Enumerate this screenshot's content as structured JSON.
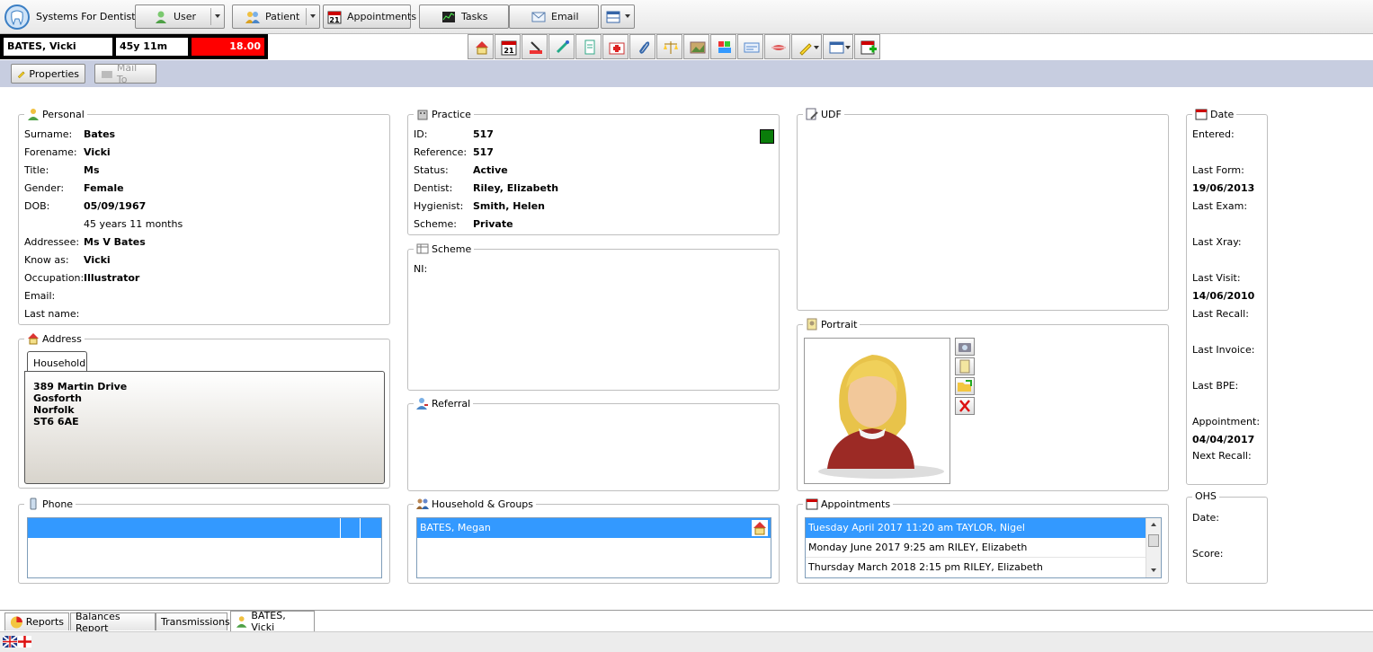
{
  "app": {
    "title": "Systems For Dentists"
  },
  "toolbar": {
    "user": "User",
    "patient": "Patient",
    "appointments": "Appointments",
    "tasks": "Tasks",
    "email": "Email"
  },
  "patient_bar": {
    "name": "BATES, Vicki",
    "age": "45y 11m",
    "balance": "18.00"
  },
  "subtoolbar": {
    "properties": "Properties",
    "mail_to": "Mail To"
  },
  "personal": {
    "title": "Personal",
    "rows": [
      {
        "label": "Surname:",
        "value": "Bates"
      },
      {
        "label": "Forename:",
        "value": "Vicki"
      },
      {
        "label": "Title:",
        "value": "Ms"
      },
      {
        "label": "Gender:",
        "value": "Female"
      },
      {
        "label": "DOB:",
        "value": "05/09/1967"
      },
      {
        "label": "",
        "value": "45 years 11 months"
      },
      {
        "label": "Addressee:",
        "value": "Ms V Bates"
      },
      {
        "label": "Know as:",
        "value": "Vicki"
      },
      {
        "label": "Occupation:",
        "value": "Illustrator"
      },
      {
        "label": "Email:",
        "value": ""
      },
      {
        "label": "Last name:",
        "value": ""
      }
    ]
  },
  "address": {
    "title": "Address",
    "tab": "Household",
    "lines": [
      "389 Martin Drive",
      "Gosforth",
      "Norfolk",
      "ST6 6AE"
    ]
  },
  "phone": {
    "title": "Phone"
  },
  "practice": {
    "title": "Practice",
    "rows": [
      {
        "label": "ID:",
        "value": "517"
      },
      {
        "label": "Reference:",
        "value": "517"
      },
      {
        "label": "Status:",
        "value": "Active"
      },
      {
        "label": "Dentist:",
        "value": "Riley, Elizabeth"
      },
      {
        "label": "Hygienist:",
        "value": "Smith, Helen"
      },
      {
        "label": "Scheme:",
        "value": "Private"
      }
    ],
    "status_color": "#0a7d0a"
  },
  "scheme": {
    "title": "Scheme",
    "ni_label": "NI:"
  },
  "referral": {
    "title": "Referral"
  },
  "household": {
    "title": "Household & Groups",
    "items": [
      "BATES, Megan"
    ]
  },
  "udf": {
    "title": "UDF"
  },
  "portrait": {
    "title": "Portrait"
  },
  "appointments": {
    "title": "Appointments",
    "items": [
      "Tuesday April 2017 11:20 am TAYLOR, Nigel",
      "Monday June 2017 9:25 am RILEY, Elizabeth",
      "Thursday March 2018 2:15 pm RILEY, Elizabeth"
    ]
  },
  "date": {
    "title": "Date",
    "rows": [
      {
        "label": "Entered:",
        "value": ""
      },
      {
        "label": "Last Form:",
        "value": "19/06/2013"
      },
      {
        "label": "Last Exam:",
        "value": ""
      },
      {
        "label": "Last Xray:",
        "value": ""
      },
      {
        "label": "Last Visit:",
        "value": "14/06/2010"
      },
      {
        "label": "Last Recall:",
        "value": ""
      },
      {
        "label": "Last Invoice:",
        "value": ""
      },
      {
        "label": "Last BPE:",
        "value": ""
      },
      {
        "label": "Appointment:",
        "value": "04/04/2017"
      },
      {
        "label": "Next Recall:",
        "value": ""
      }
    ]
  },
  "ohs": {
    "title": "OHS",
    "date_label": "Date:",
    "score_label": "Score:"
  },
  "bottom_tabs": [
    "Reports",
    "Balances Report",
    "Transmissions",
    "BATES, Vicki"
  ],
  "colors": {
    "balance_bg": "#ff0000",
    "selection": "#3399ff",
    "subtoolbar_bg": "#c7cde0"
  }
}
